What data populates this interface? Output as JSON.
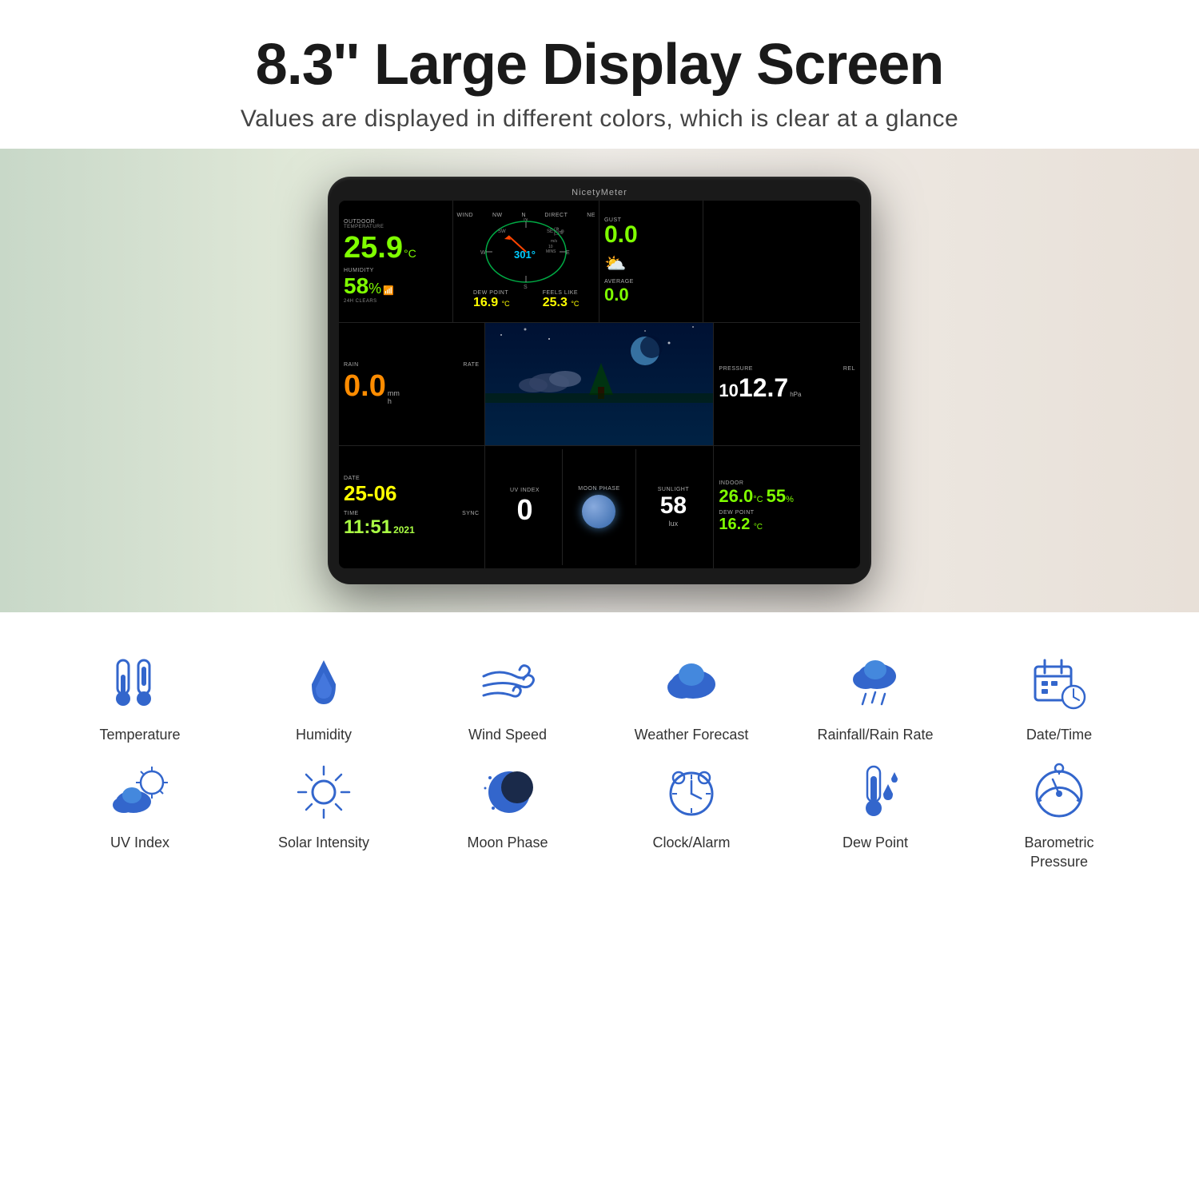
{
  "header": {
    "title": "8.3'' Large Display Screen",
    "subtitle": "Values are displayed in different colors, which is clear at a glance"
  },
  "device": {
    "brand": "NicetyMeter",
    "screen": {
      "outdoor": {
        "label": "OUTDOOR",
        "sublabel": "TEMPERATURE",
        "value": "25.9",
        "unit": "°C"
      },
      "humidity": {
        "label": "HUMIDITY",
        "value": "58",
        "unit": "%",
        "sublabel": "24h CLEARS"
      },
      "wind": {
        "label": "WIND",
        "direction_label": "NW",
        "direct_label": "NE",
        "value": "301°",
        "mins": "10 MINS"
      },
      "gust": {
        "label": "GUST",
        "value": "0.0",
        "unit": "m/s"
      },
      "average": {
        "label": "AVERAGE",
        "value": "0.0"
      },
      "dew_point": {
        "label": "DEW POINT",
        "value": "16.9",
        "unit": "°C"
      },
      "feels_like": {
        "label": "FEELS LIKE",
        "value": "25.3",
        "unit": "°C"
      },
      "rain": {
        "label": "RAIN",
        "sublabel": "RATE",
        "value": "0.0",
        "unit": "mm/h"
      },
      "pressure": {
        "label": "PRESSURE",
        "sublabel": "REL",
        "value1": "10",
        "value2": "12.7",
        "unit": "hPa"
      },
      "date": {
        "label": "DATE",
        "value": "25-06"
      },
      "time": {
        "label": "TIME",
        "sublabel": "SYNC",
        "value": "11:51",
        "year": "2021"
      },
      "uv_index": {
        "label": "UV INDEX",
        "value": "0"
      },
      "moon_phase": {
        "label": "MOON PHASE"
      },
      "sunlight": {
        "label": "SUNLIGHT",
        "value": "58",
        "unit": "lux"
      },
      "indoor": {
        "label": "INDOOR",
        "temp": "26.0",
        "temp_unit": "°C",
        "humidity": "55",
        "humidity_unit": "%"
      },
      "indoor_dew": {
        "label": "DEW POINT",
        "value": "16.2",
        "unit": "°C"
      }
    }
  },
  "features": {
    "row1": [
      {
        "id": "temperature",
        "label": "Temperature"
      },
      {
        "id": "humidity",
        "label": "Humidity"
      },
      {
        "id": "wind-speed",
        "label": "Wind Speed"
      },
      {
        "id": "weather-forecast",
        "label": "Weather Forecast"
      },
      {
        "id": "rainfall",
        "label": "Rainfall/Rain Rate"
      },
      {
        "id": "datetime",
        "label": "Date/Time"
      }
    ],
    "row2": [
      {
        "id": "uv-index",
        "label": "UV Index"
      },
      {
        "id": "solar-intensity",
        "label": "Solar Intensity"
      },
      {
        "id": "moon-phase",
        "label": "Moon Phase"
      },
      {
        "id": "clock-alarm",
        "label": "Clock/Alarm"
      },
      {
        "id": "dew-point",
        "label": "Dew Point"
      },
      {
        "id": "barometric-pressure",
        "label": "Barometric Pressure"
      }
    ]
  },
  "colors": {
    "accent_blue": "#4477cc",
    "screen_bg": "#000000",
    "device_bg": "#1a1a1a"
  }
}
